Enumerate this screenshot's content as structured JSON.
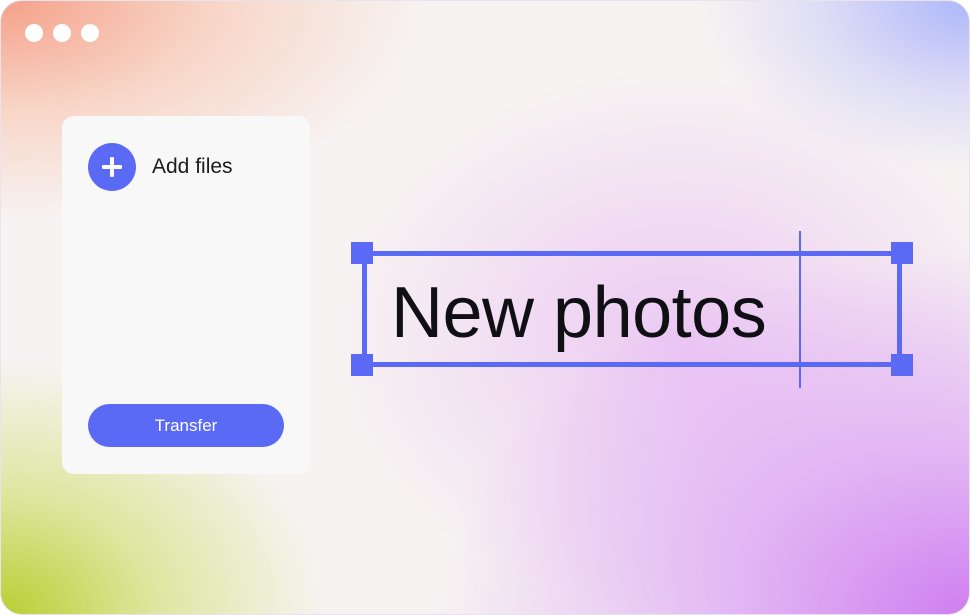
{
  "window": {
    "controls": [
      "window-dot",
      "window-dot",
      "window-dot"
    ]
  },
  "panel": {
    "add_files_label": "Add files",
    "add_icon": "plus-icon",
    "transfer_label": "Transfer"
  },
  "editor": {
    "text_value": "New photos"
  },
  "colors": {
    "accent": "#5b6af4",
    "panel_bg": "#f8f8f8",
    "text_dark": "#1b1b1b"
  }
}
